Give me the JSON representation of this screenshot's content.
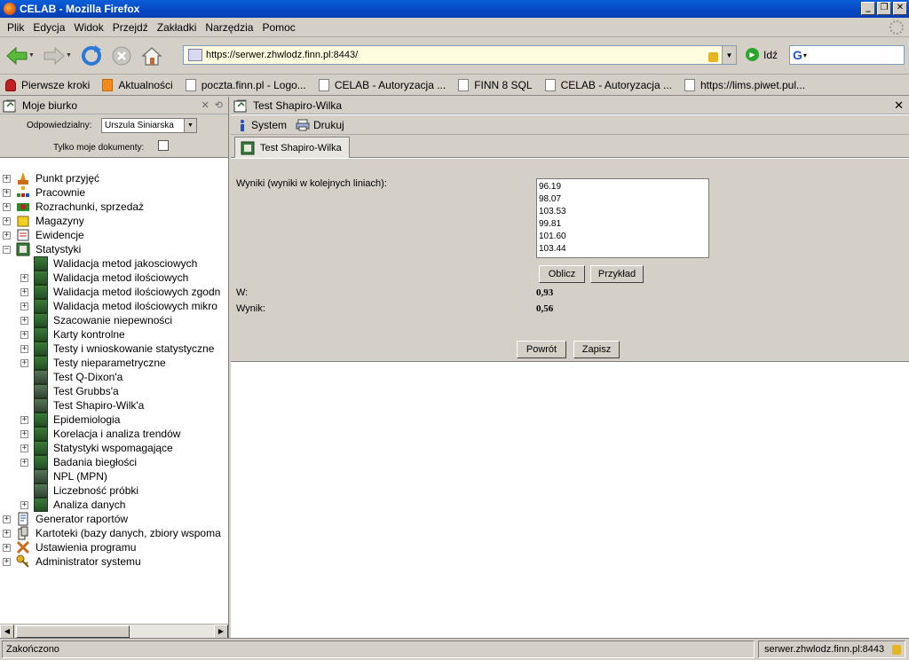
{
  "window": {
    "title": "CELAB - Mozilla Firefox"
  },
  "menu": [
    "Plik",
    "Edycja",
    "Widok",
    "Przejdź",
    "Zakładki",
    "Narzędzia",
    "Pomoc"
  ],
  "nav": {
    "url": "https://serwer.zhwlodz.finn.pl:8443/",
    "go_label": "Idź",
    "search_value": ""
  },
  "bookmarks": [
    "Pierwsze kroki",
    "Aktualności",
    "poczta.finn.pl - Logo...",
    "CELAB - Autoryzacja ...",
    "FINN 8 SQL",
    "CELAB - Autoryzacja ...",
    "https://lims.piwet.pul..."
  ],
  "left": {
    "title": "Moje biurko",
    "responsible_label": "Odpowiedzialny:",
    "responsible_value": "Urszula Siniarska",
    "only_mine_label": "Tylko moje dokumenty:",
    "tree": [
      "Punkt przyjęć",
      "Pracownie",
      "Rozrachunki, sprzedaż",
      "Magazyny",
      "Ewidencje",
      "Statystyki",
      "Walidacja metod jakosciowych",
      "Walidacja metod ilościowych",
      "Walidacja metod ilościowych zgodn",
      "Walidacja metod ilościowych mikro",
      "Szacowanie niepewności",
      "Karty kontrolne",
      "Testy i wnioskowanie statystyczne",
      "Testy nieparametryczne",
      "Test Q-Dixon'a",
      "Test Grubbs'a",
      "Test Shapiro-Wilk'a",
      "Epidemiologia",
      "Korelacja i analiza trendów",
      "Statystyki wspomagające",
      "Badania biegłości",
      "NPL (MPN)",
      "Liczebność próbki",
      "Analiza danych",
      "Generator raportów",
      "Kartoteki (bazy danych, zbiory wspoma",
      "Ustawienia programu",
      "Administrator systemu"
    ]
  },
  "right": {
    "title": "Test Shapiro-Wilka",
    "toolbar": {
      "system": "System",
      "print": "Drukuj"
    },
    "tab": "Test Shapiro-Wilka",
    "results_label": "Wyniki (wyniki w kolejnych liniach):",
    "results": [
      "96.19",
      "98.07",
      "103.53",
      "99.81",
      "101.60",
      "103.44"
    ],
    "calc_button": "Oblicz",
    "example_button": "Przykład",
    "w_label": "W:",
    "w_value": "0,93",
    "result_label": "Wynik:",
    "result_value": "0,56",
    "back_button": "Powrót",
    "save_button": "Zapisz"
  },
  "status": {
    "left": "Zakończono",
    "right": "serwer.zhwlodz.finn.pl:8443"
  }
}
